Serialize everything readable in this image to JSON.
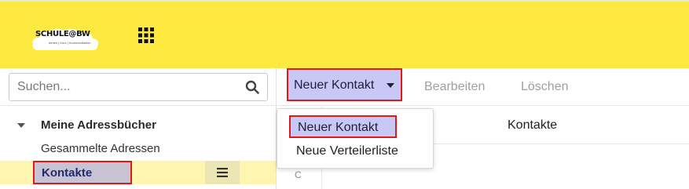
{
  "header": {
    "logo_text": "SCHULE@BW",
    "logo_subtitle": "lernen | Kurs | Kommunikation",
    "apps_icon": "grid-icon",
    "background_color": "#fde93f"
  },
  "sidebar": {
    "search": {
      "placeholder": "Suchen...",
      "value": ""
    },
    "tree": {
      "root_label": "Meine Adressbücher",
      "items": [
        {
          "label": "Gesammelte Adressen"
        },
        {
          "label": "Kontakte",
          "active": true
        }
      ]
    }
  },
  "toolbar": {
    "new_contact_label": "Neuer Kontakt",
    "edit_label": "Bearbeiten",
    "delete_label": "Löschen"
  },
  "dropdown": {
    "items": [
      {
        "label": "Neuer Kontakt"
      },
      {
        "label": "Neue Verteilerliste"
      }
    ]
  },
  "list": {
    "title": "Kontakte",
    "index_letter": "C"
  },
  "colors": {
    "accent": "#c8c8f6",
    "highlight_border": "#e01818",
    "active_row": "#fef6b0"
  }
}
